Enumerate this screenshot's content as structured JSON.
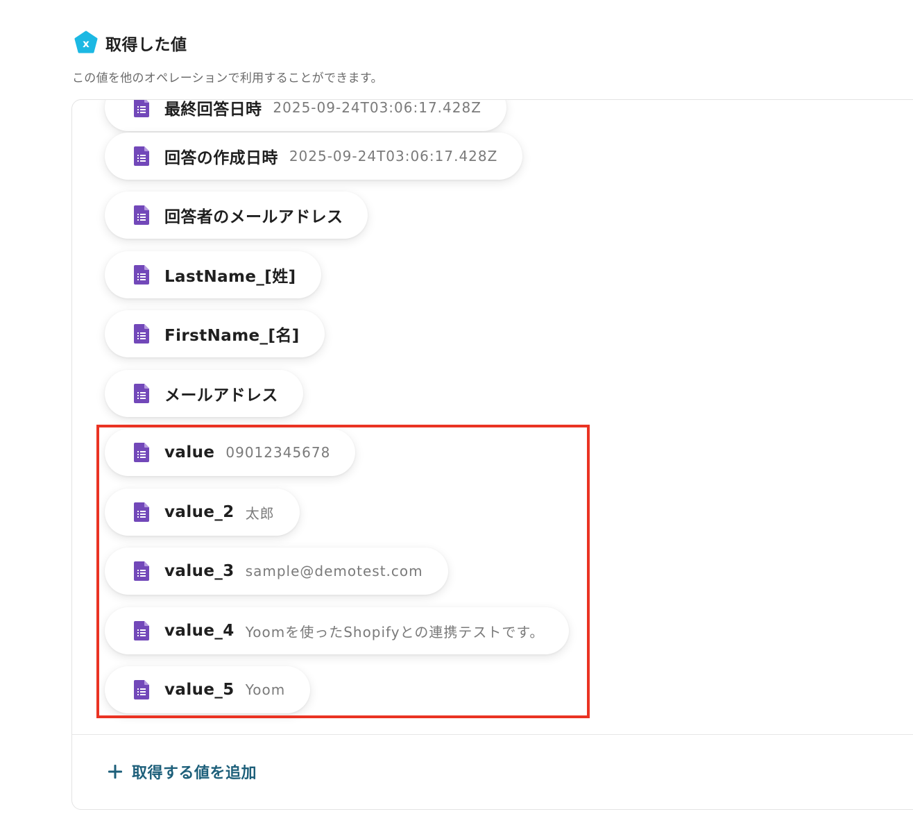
{
  "header": {
    "title": "取得した値",
    "badge_letter": "x",
    "badge_color": "#1cb8e3"
  },
  "subtitle": "この値を他のオペレーションで利用することができます。",
  "items": [
    {
      "label": "最終回答日時",
      "value": "2025-09-24T03:06:17.428Z"
    },
    {
      "label": "回答の作成日時",
      "value": "2025-09-24T03:06:17.428Z"
    },
    {
      "label": "回答者のメールアドレス",
      "value": ""
    },
    {
      "label": "LastName_[姓]",
      "value": ""
    },
    {
      "label": "FirstName_[名]",
      "value": ""
    },
    {
      "label": "メールアドレス",
      "value": ""
    },
    {
      "label": "value",
      "value": "09012345678"
    },
    {
      "label": "value_2",
      "value": "太郎"
    },
    {
      "label": "value_3",
      "value": "sample@demotest.com"
    },
    {
      "label": "value_4",
      "value": "Yoomを使ったShopifyとの連携テストです。"
    },
    {
      "label": "value_5",
      "value": "Yoom"
    }
  ],
  "item_icon": "google-forms-document-icon",
  "item_icon_color": "#7248b9",
  "add_button": {
    "label": "取得する値を追加",
    "icon": "plus-icon",
    "color": "#1d5f7a"
  },
  "highlight_color": "#ea3323"
}
